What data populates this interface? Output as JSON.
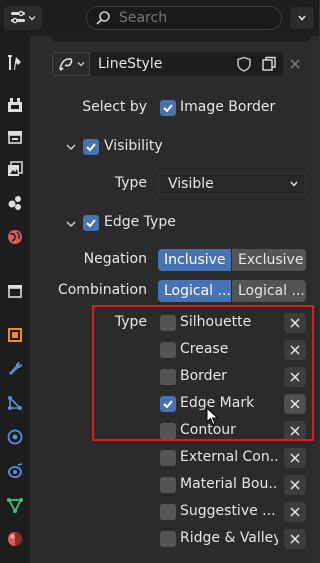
{
  "topbar": {
    "search_placeholder": "Search",
    "header_fragment": "....."
  },
  "linestyle": {
    "name": "LineStyle"
  },
  "select_by": {
    "label": "Select by",
    "image_border_label": "Image Border",
    "image_border_checked": true
  },
  "visibility": {
    "label": "Visibility",
    "checked": true,
    "type_label": "Type",
    "type_value": "Visible"
  },
  "edge_type": {
    "label": "Edge Type",
    "checked": true,
    "negation_label": "Negation",
    "negation_options": [
      "Inclusive",
      "Exclusive"
    ],
    "negation_selected": "Inclusive",
    "combination_label": "Combination",
    "combination_options": [
      "Logical ...",
      "Logical ..."
    ],
    "combination_selected_index": 0,
    "type_label": "Type",
    "items": [
      {
        "label": "Silhouette",
        "checked": false
      },
      {
        "label": "Crease",
        "checked": false
      },
      {
        "label": "Border",
        "checked": false
      },
      {
        "label": "Edge Mark",
        "checked": true
      },
      {
        "label": "Contour",
        "checked": false
      },
      {
        "label": "External Con...",
        "checked": false
      },
      {
        "label": "Material Bou...",
        "checked": false
      },
      {
        "label": "Suggestive ...",
        "checked": false
      },
      {
        "label": "Ridge & Valley",
        "checked": false
      }
    ]
  },
  "colors": {
    "accent": "#4772b3",
    "highlight_box": "#e11b1b"
  },
  "tabs": [
    "tool-icon",
    "render-icon",
    "output-icon",
    "view-layer-icon",
    "scene-icon",
    "world-icon",
    "collection-icon",
    "object-icon",
    "modifier-icon",
    "particles-icon",
    "physics-icon",
    "constraints-icon",
    "data-icon",
    "material-icon"
  ]
}
